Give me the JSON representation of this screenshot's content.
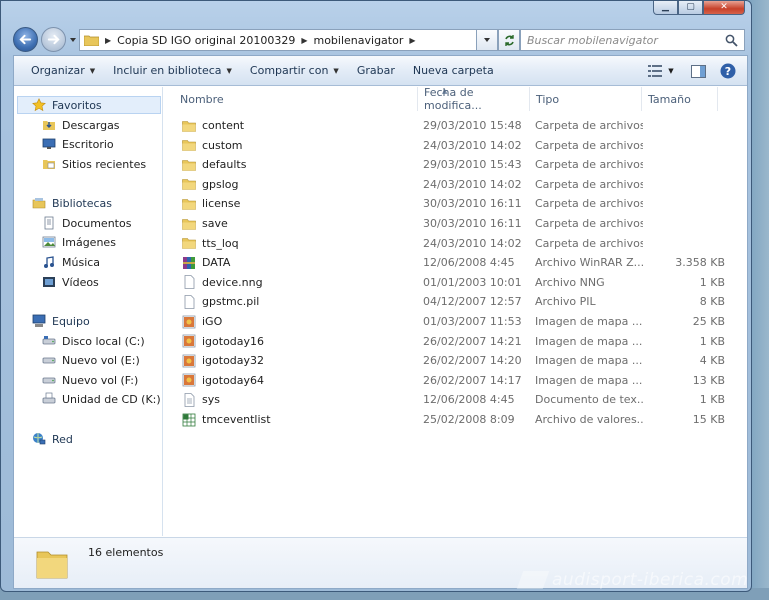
{
  "window": {
    "caption_buttons": {
      "minimize": "▁",
      "maximize": "▢",
      "close": "✕"
    }
  },
  "address_bar": {
    "path": [
      "Copia SD IGO original 20100329",
      "mobilenavigator"
    ],
    "refresh_icon": "refresh-icon"
  },
  "search": {
    "placeholder": "Buscar mobilenavigator"
  },
  "toolbar": {
    "organize": "Organizar",
    "include": "Incluir en biblioteca",
    "share": "Compartir con",
    "burn": "Grabar",
    "new_folder": "Nueva carpeta"
  },
  "navpane": {
    "favorites": {
      "title": "Favoritos",
      "items": [
        "Descargas",
        "Escritorio",
        "Sitios recientes"
      ]
    },
    "libraries": {
      "title": "Bibliotecas",
      "items": [
        "Documentos",
        "Imágenes",
        "Música",
        "Vídeos"
      ]
    },
    "computer": {
      "title": "Equipo",
      "items": [
        "Disco local (C:)",
        "Nuevo vol (E:)",
        "Nuevo vol (F:)",
        "Unidad de CD (K:) W"
      ]
    },
    "network": {
      "title": "Red"
    }
  },
  "columns": {
    "name": "Nombre",
    "date": "Fecha de modifica...",
    "type": "Tipo",
    "size": "Tamaño"
  },
  "files": [
    {
      "name": "content",
      "date": "29/03/2010 15:48",
      "type": "Carpeta de archivos",
      "size": "",
      "icon": "folder"
    },
    {
      "name": "custom",
      "date": "24/03/2010 14:02",
      "type": "Carpeta de archivos",
      "size": "",
      "icon": "folder"
    },
    {
      "name": "defaults",
      "date": "29/03/2010 15:43",
      "type": "Carpeta de archivos",
      "size": "",
      "icon": "folder"
    },
    {
      "name": "gpslog",
      "date": "24/03/2010 14:02",
      "type": "Carpeta de archivos",
      "size": "",
      "icon": "folder"
    },
    {
      "name": "license",
      "date": "30/03/2010 16:11",
      "type": "Carpeta de archivos",
      "size": "",
      "icon": "folder"
    },
    {
      "name": "save",
      "date": "30/03/2010 16:11",
      "type": "Carpeta de archivos",
      "size": "",
      "icon": "folder"
    },
    {
      "name": "tts_loq",
      "date": "24/03/2010 14:02",
      "type": "Carpeta de archivos",
      "size": "",
      "icon": "folder"
    },
    {
      "name": "DATA",
      "date": "12/06/2008 4:45",
      "type": "Archivo WinRAR Z...",
      "size": "3.358 KB",
      "icon": "rar"
    },
    {
      "name": "device.nng",
      "date": "01/01/2003 10:01",
      "type": "Archivo NNG",
      "size": "1 KB",
      "icon": "file"
    },
    {
      "name": "gpstmc.pil",
      "date": "04/12/2007 12:57",
      "type": "Archivo PIL",
      "size": "8 KB",
      "icon": "file"
    },
    {
      "name": "iGO",
      "date": "01/03/2007 11:53",
      "type": "Imagen de mapa ...",
      "size": "25 KB",
      "icon": "bmp"
    },
    {
      "name": "igotoday16",
      "date": "26/02/2007 14:21",
      "type": "Imagen de mapa ...",
      "size": "1 KB",
      "icon": "bmp"
    },
    {
      "name": "igotoday32",
      "date": "26/02/2007 14:20",
      "type": "Imagen de mapa ...",
      "size": "4 KB",
      "icon": "bmp"
    },
    {
      "name": "igotoday64",
      "date": "26/02/2007 14:17",
      "type": "Imagen de mapa ...",
      "size": "13 KB",
      "icon": "bmp"
    },
    {
      "name": "sys",
      "date": "12/06/2008 4:45",
      "type": "Documento de tex...",
      "size": "1 KB",
      "icon": "txt"
    },
    {
      "name": "tmceventlist",
      "date": "25/02/2008 8:09",
      "type": "Archivo de valores...",
      "size": "15 KB",
      "icon": "csv"
    }
  ],
  "details": {
    "count": "16 elementos"
  },
  "watermark": "audisport-iberica.com",
  "colors": {
    "folder": "#e8c65a",
    "selection": "#e3eefb",
    "accent": "#1e3653"
  }
}
